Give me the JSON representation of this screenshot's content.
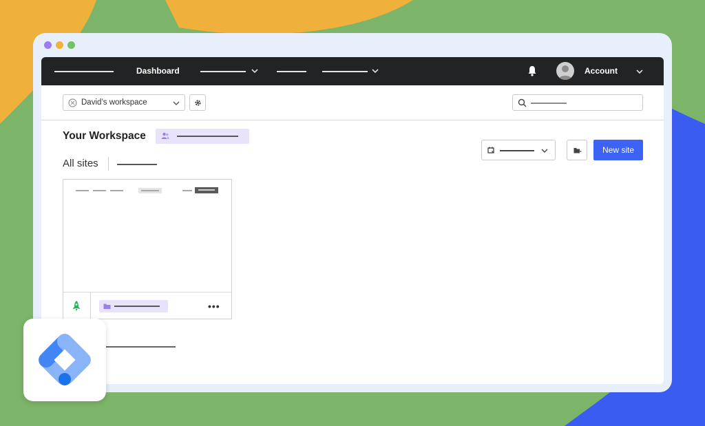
{
  "window": {
    "dots": [
      "#9c7cf0",
      "#f2b13a",
      "#72c362"
    ]
  },
  "navbar": {
    "dashboard_label": "Dashboard",
    "account_label": "Account"
  },
  "toolbar": {
    "workspace_select": "David’s workspace"
  },
  "main": {
    "title": "Your Workspace",
    "all_sites_label": "All sites",
    "new_site_label": "New site"
  },
  "icons": {
    "bell": "bell-icon",
    "avatar": "user-avatar",
    "gear": "gear-icon",
    "search": "search-icon",
    "calendar": "calendar-icon",
    "folder": "folder-icon",
    "rocket": "rocket-icon",
    "more": "more-horizontal-icon",
    "logo": "google-tag-manager-logo"
  },
  "colors": {
    "accent": "#3d63f5",
    "badge_bg": "#e8e3fb",
    "badge_icon": "#9b7fe8",
    "rocket": "#1db954",
    "navbar_bg": "#222324"
  }
}
